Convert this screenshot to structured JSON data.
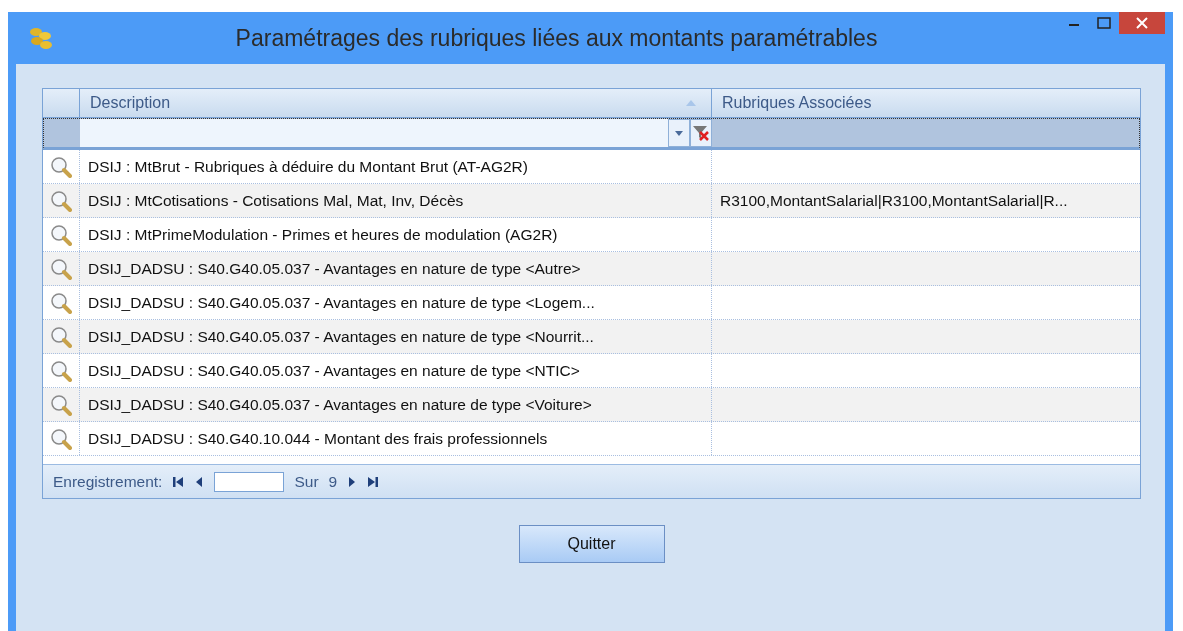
{
  "window": {
    "title": "Paramétrages des rubriques liées aux montants paramétrables"
  },
  "table": {
    "columns": [
      {
        "label": "Description",
        "sorted": true
      },
      {
        "label": "Rubriques Associées",
        "sorted": false
      }
    ],
    "rows": [
      {
        "description": "DSIJ : MtBrut - Rubriques à déduire du Montant Brut (AT-AG2R)",
        "rubriques": ""
      },
      {
        "description": "DSIJ : MtCotisations - Cotisations Mal, Mat, Inv, Décès",
        "rubriques": "R3100,MontantSalarial|R3100,MontantSalarial|R..."
      },
      {
        "description": "DSIJ : MtPrimeModulation - Primes et heures de modulation (AG2R)",
        "rubriques": ""
      },
      {
        "description": "DSIJ_DADSU : S40.G40.05.037 - Avantages en nature de type <Autre>",
        "rubriques": ""
      },
      {
        "description": "DSIJ_DADSU : S40.G40.05.037 - Avantages en nature de type <Logem...",
        "rubriques": ""
      },
      {
        "description": "DSIJ_DADSU : S40.G40.05.037 - Avantages en nature de type <Nourrit...",
        "rubriques": ""
      },
      {
        "description": "DSIJ_DADSU : S40.G40.05.037 - Avantages en nature de type <NTIC>",
        "rubriques": ""
      },
      {
        "description": "DSIJ_DADSU : S40.G40.05.037 - Avantages en nature de type <Voiture>",
        "rubriques": ""
      },
      {
        "description": "DSIJ_DADSU : S40.G40.10.044 - Montant des frais professionnels",
        "rubriques": ""
      }
    ]
  },
  "navigator": {
    "label": "Enregistrement:",
    "of": "Sur",
    "total": "9"
  },
  "buttons": [
    "Quitter"
  ]
}
